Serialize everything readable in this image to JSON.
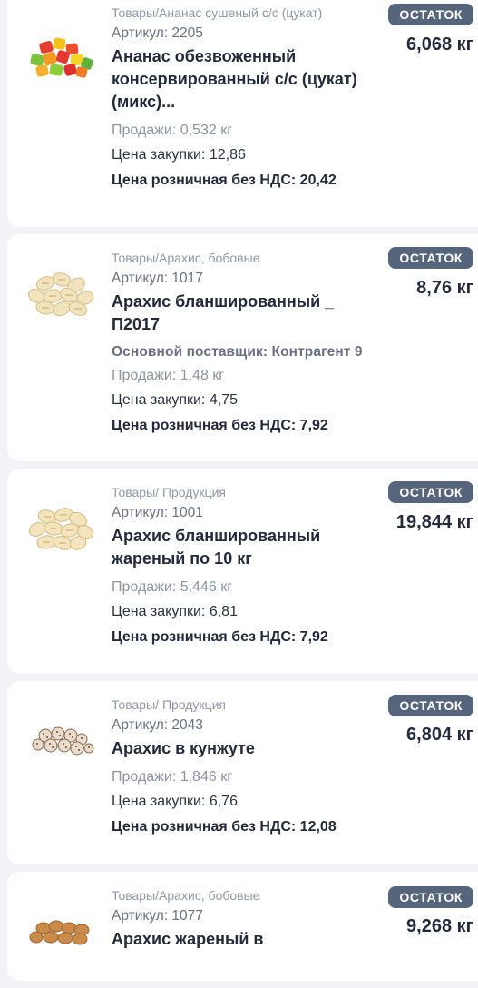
{
  "products": [
    {
      "category": "Товары/Ананас сушеный с/с (цукат)",
      "article": "Артикул: 2205",
      "title": "Ананас обезвоженный консервированный с/с (цукат) (микс)...",
      "sales": "Продажи: 0,532 кг",
      "purchase": "Цена закупки: 12,86",
      "retail": "Цена розничная без НДС: 20,42",
      "badge": "Остаток",
      "stock": "6,068 кг",
      "image_icon": "candied-fruit-icon"
    },
    {
      "category": "Товары/Арахис, бобовые",
      "article": "Артикул: 1017",
      "title": "Арахис бланшированный _ П2017",
      "supplier": "Основной поставщик: Контрагент 9",
      "sales": "Продажи: 1,48 кг",
      "purchase": "Цена закупки: 4,75",
      "retail": "Цена розничная без НДС: 7,92",
      "badge": "Остаток",
      "stock": "8,76 кг",
      "image_icon": "peanuts-icon"
    },
    {
      "category": "Товары/ Продукция",
      "article": "Артикул: 1001",
      "title": "Арахис бланшированный жареный по 10 кг",
      "sales": "Продажи: 5,446 кг",
      "purchase": "Цена закупки: 6,81",
      "retail": "Цена розничная без НДС: 7,92",
      "badge": "Остаток",
      "stock": "19,844 кг",
      "image_icon": "peanuts-icon"
    },
    {
      "category": "Товары/ Продукция",
      "article": "Артикул: 2043",
      "title": "Арахис в кунжуте",
      "sales": "Продажи: 1,846 кг",
      "purchase": "Цена закупки: 6,76",
      "retail": "Цена розничная без НДС: 12,08",
      "badge": "Остаток",
      "stock": "6,804 кг",
      "image_icon": "sesame-peanuts-icon"
    },
    {
      "category": "Товары/Арахис, бобовые",
      "article": "Артикул: 1077",
      "title": "Арахис жареный в",
      "badge": "Остаток",
      "stock": "9,268 кг",
      "image_icon": "roasted-peanuts-icon"
    }
  ]
}
